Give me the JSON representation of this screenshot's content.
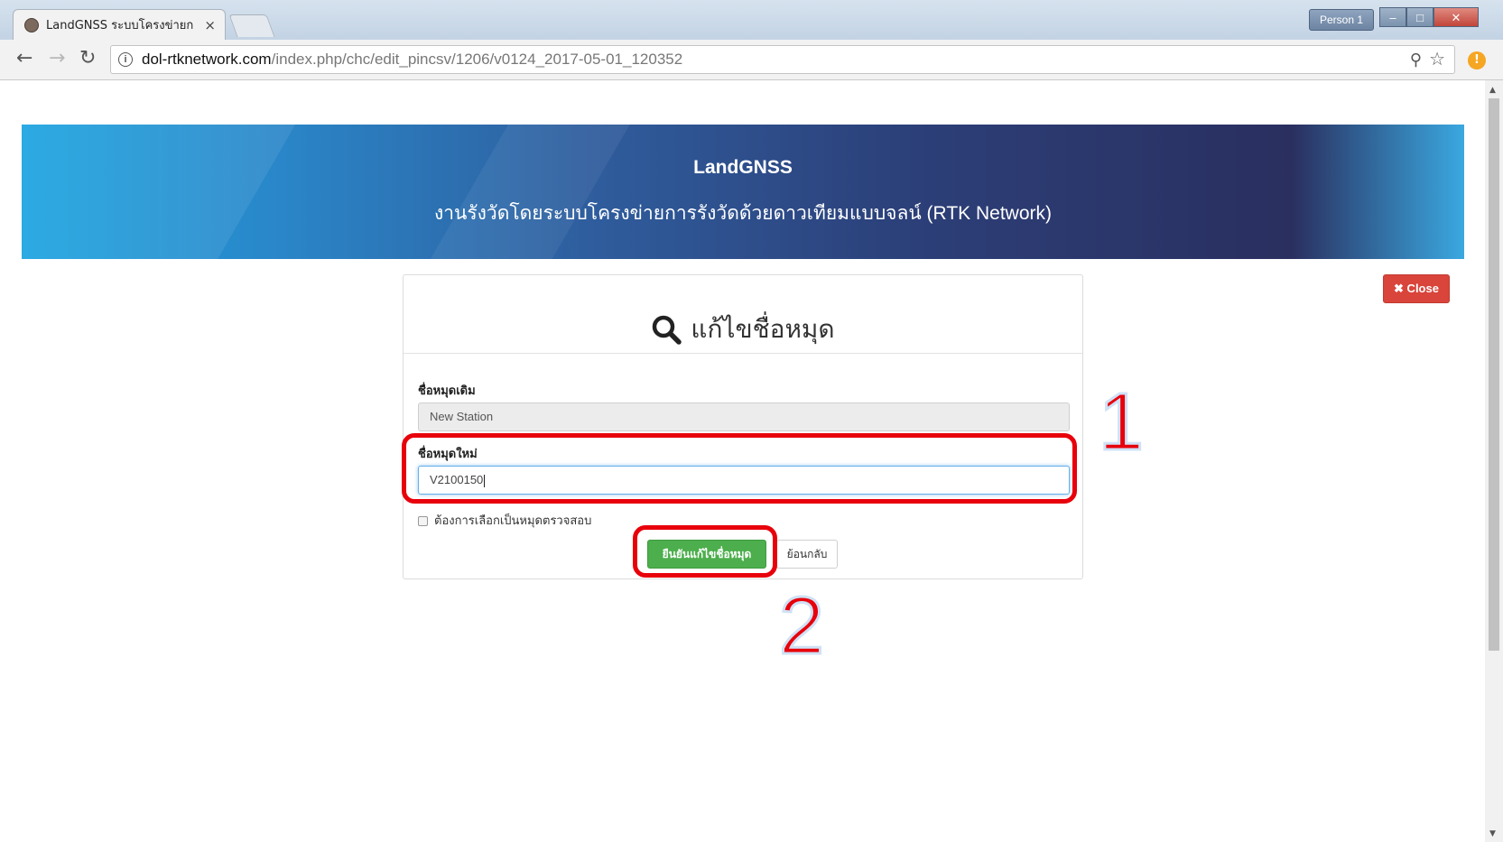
{
  "browser": {
    "tab_title": "LandGNSS ระบบโครงข่ายก",
    "tab_close_icon": "×",
    "person_label": "Person 1",
    "window_minimize": "–",
    "window_maximize": "□",
    "window_close": "✕",
    "url_host": "dol-rtknetwork.com",
    "url_path": "/index.php/chc/edit_pincsv/1206/v0124_2017-05-01_120352",
    "extension_badge": "!"
  },
  "banner": {
    "title": "LandGNSS",
    "subtitle": "งานรังวัดโดยระบบโครงข่ายการรังวัดด้วยดาวเทียมแบบจลน์ (RTK Network)"
  },
  "close_button": {
    "label": "✖ Close"
  },
  "form": {
    "heading": "แก้ไขชื่อหมุด",
    "old_name_label": "ชื่อหมุดเดิม",
    "old_name_value": "New Station",
    "new_name_label": "ชื่อหมุดใหม่",
    "new_name_value": "V2100150",
    "checkbox_label": "ต้องการเลือกเป็นหมุดตรวจสอบ",
    "confirm_button": "ยืนยันแก้ไขชื่อหมุด",
    "back_button": "ย้อนกลับ"
  },
  "annotations": {
    "step1": "1",
    "step2": "2",
    "color": "#e8000b"
  }
}
